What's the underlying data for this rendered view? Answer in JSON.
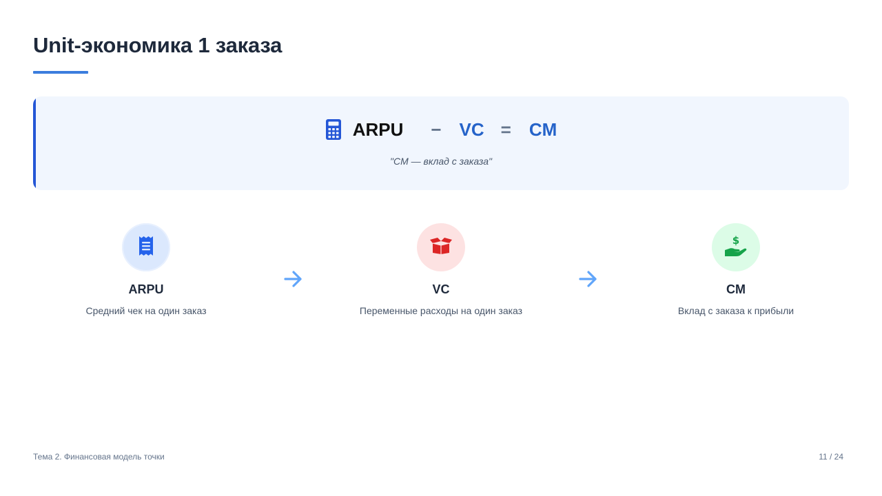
{
  "slide": {
    "title": "Unit-экономика 1 заказа"
  },
  "formula": {
    "icon": "calculator-icon",
    "term_arpu": "ARPU",
    "minus": "−",
    "term_vc": "VC",
    "equals": "=",
    "term_cm": "CM",
    "note": "\"CM — вклад с заказа\""
  },
  "steps": [
    {
      "icon": "receipt-icon",
      "label": "ARPU",
      "description": "Средний чек на один заказ",
      "color": "#2563eb",
      "bg": "#dbe8fd"
    },
    {
      "icon": "box-open-icon",
      "label": "VC",
      "description": "Переменные расходы на один заказ",
      "color": "#dc2626",
      "bg": "#fde2e2"
    },
    {
      "icon": "hand-dollar-icon",
      "label": "CM",
      "description": "Вклад с заказа к прибыли",
      "color": "#16a34a",
      "bg": "#dcfce7"
    }
  ],
  "colors": {
    "accent": "#2456d6",
    "arrow": "#60a5fa",
    "title": "#1e293b"
  },
  "footer": {
    "topic": "Тема 2. Финансовая модель точки",
    "page": "11 / 24"
  }
}
